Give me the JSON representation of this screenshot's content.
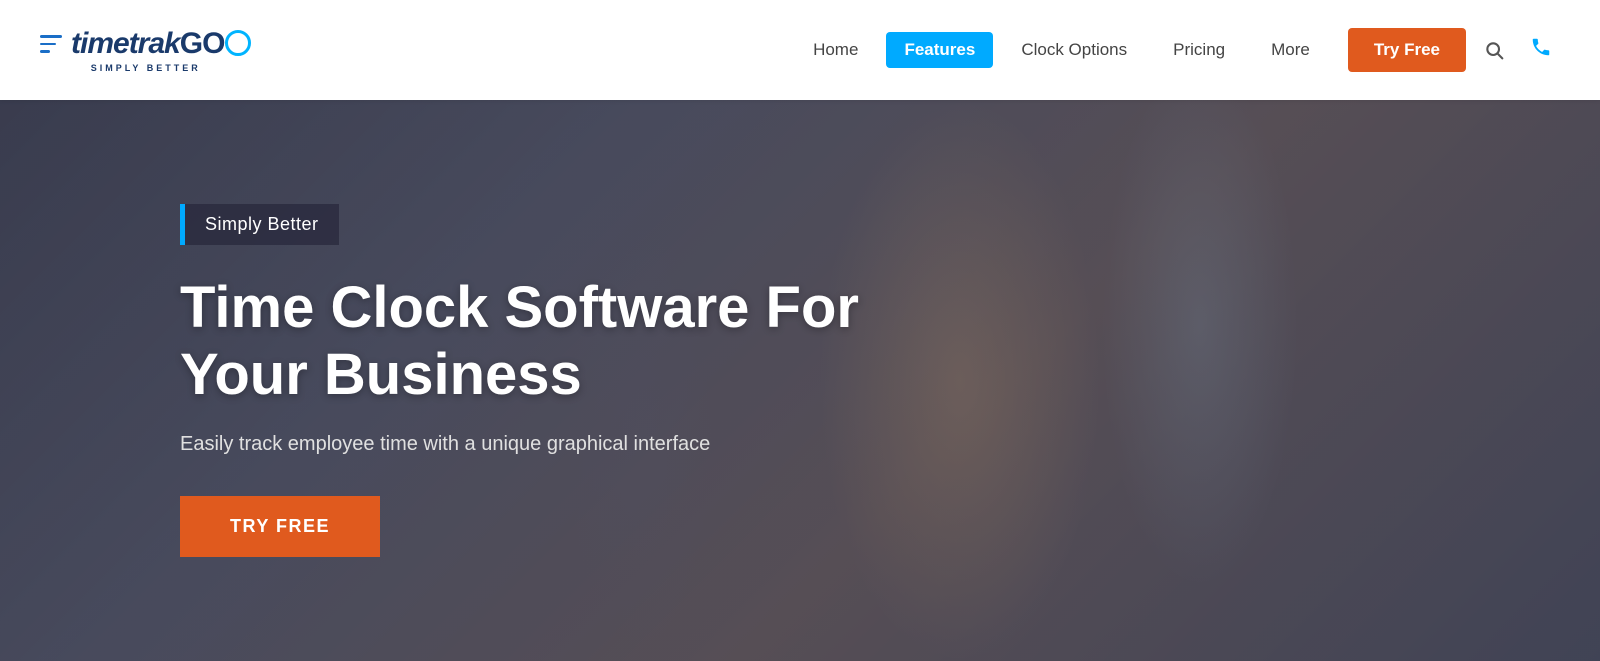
{
  "header": {
    "logo": {
      "brand_name": "timetrakGO",
      "subtitle": "SIMPLY BETTER"
    },
    "nav": {
      "links": [
        {
          "label": "Home",
          "active": false
        },
        {
          "label": "Features",
          "active": true
        },
        {
          "label": "Clock Options",
          "active": false
        },
        {
          "label": "Pricing",
          "active": false
        },
        {
          "label": "More",
          "active": false
        }
      ],
      "try_free_label": "Try Free",
      "search_icon": "🔍",
      "phone_icon": "📞"
    }
  },
  "hero": {
    "badge": "Simply Better",
    "title_line1": "Time Clock Software For",
    "title_line2": "Your Business",
    "subtitle": "Easily track employee time with a unique graphical interface",
    "cta_label": "TRY FREE"
  },
  "colors": {
    "accent_blue": "#00aaff",
    "accent_orange": "#e05a1e",
    "nav_active_bg": "#00aaff",
    "brand_dark": "#1a3a6b"
  }
}
